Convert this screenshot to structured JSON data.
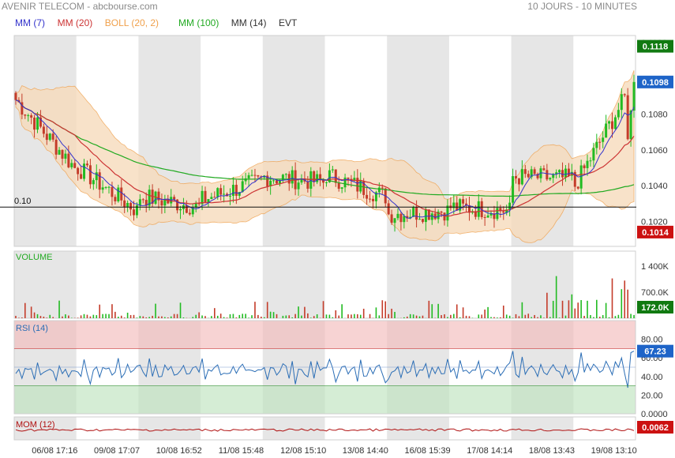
{
  "header": {
    "title": "AVENIR TELECOM - abcbourse.com",
    "period": "10 JOURS - 10 MINUTES"
  },
  "legend": [
    {
      "label": "MM (7)",
      "color": "#3333cc"
    },
    {
      "label": "MM (20)",
      "color": "#cc3333"
    },
    {
      "label": "BOLL (20, 2)",
      "color": "#f0a04b"
    },
    {
      "label": "MM (100)",
      "color": "#22aa22"
    },
    {
      "label": "MM (14)",
      "color": "#333333"
    },
    {
      "label": "EVT",
      "color": "#333333"
    }
  ],
  "colors": {
    "up": "#22bb22",
    "down": "#c43c2a",
    "boll_fill": "#f7dcbc",
    "boll_line": "#f0a04b",
    "mm7": "#3333cc",
    "mm20": "#cc3333",
    "mm100": "#22aa22",
    "rsi": "#2a6db5",
    "mom": "#b01010",
    "shade": "#e6e6e6",
    "badge_green": "#117a11",
    "badge_blue": "#1e64c8",
    "badge_red": "#cc1111"
  },
  "chart_data": [
    {
      "type": "candlestick",
      "panel": "price",
      "x_labels": [
        "06/08 17:16",
        "09/08 17:07",
        "10/08 16:52",
        "11/08 15:48",
        "12/08 15:10",
        "13/08 14:40",
        "16/08 15:39",
        "17/08 14:14",
        "18/08 13:43",
        "19/08 13:10"
      ],
      "y_ticks": [
        "0.1120",
        "0.1100",
        "0.1080",
        "0.1060",
        "0.1040",
        "0.1020"
      ],
      "ylim": [
        0.1006,
        0.1124
      ],
      "reference_line": {
        "label": "0.10",
        "value": 0.1028
      },
      "badges": {
        "high": "0.1118",
        "last": "0.1098",
        "low": "0.1014"
      },
      "sessions": [
        {
          "day": "06/08",
          "open": 0.1088,
          "close": 0.105
        },
        {
          "day": "09/08",
          "open": 0.105,
          "close": 0.1026
        },
        {
          "day": "10/08",
          "open": 0.1034,
          "close": 0.1028
        },
        {
          "day": "11/08",
          "open": 0.1032,
          "close": 0.1043
        },
        {
          "day": "12/08",
          "open": 0.1045,
          "close": 0.1042
        },
        {
          "day": "13/08",
          "open": 0.1046,
          "close": 0.1034
        },
        {
          "day": "16/08",
          "open": 0.1024,
          "close": 0.1026
        },
        {
          "day": "17/08",
          "open": 0.1028,
          "close": 0.1026
        },
        {
          "day": "18/08",
          "open": 0.1045,
          "close": 0.1044
        },
        {
          "day": "19/08",
          "open": 0.104,
          "close": 0.1098
        }
      ]
    },
    {
      "type": "bar",
      "panel": "volume",
      "title": "VOLUME",
      "y_ticks": [
        "1 400K",
        "700.0K"
      ],
      "ylim": [
        0,
        1800000
      ],
      "last": "172.0K"
    },
    {
      "type": "line",
      "panel": "rsi",
      "title": "RSI (14)",
      "y_ticks": [
        "80.00",
        "60.00",
        "40.00",
        "20.00",
        "0.0000"
      ],
      "ylim": [
        0,
        100
      ],
      "overbought": 70,
      "oversold": 30,
      "last": "67.23",
      "base_level": 47
    },
    {
      "type": "line",
      "panel": "mom",
      "title": "MOM (12)",
      "last": "0.0062"
    }
  ]
}
